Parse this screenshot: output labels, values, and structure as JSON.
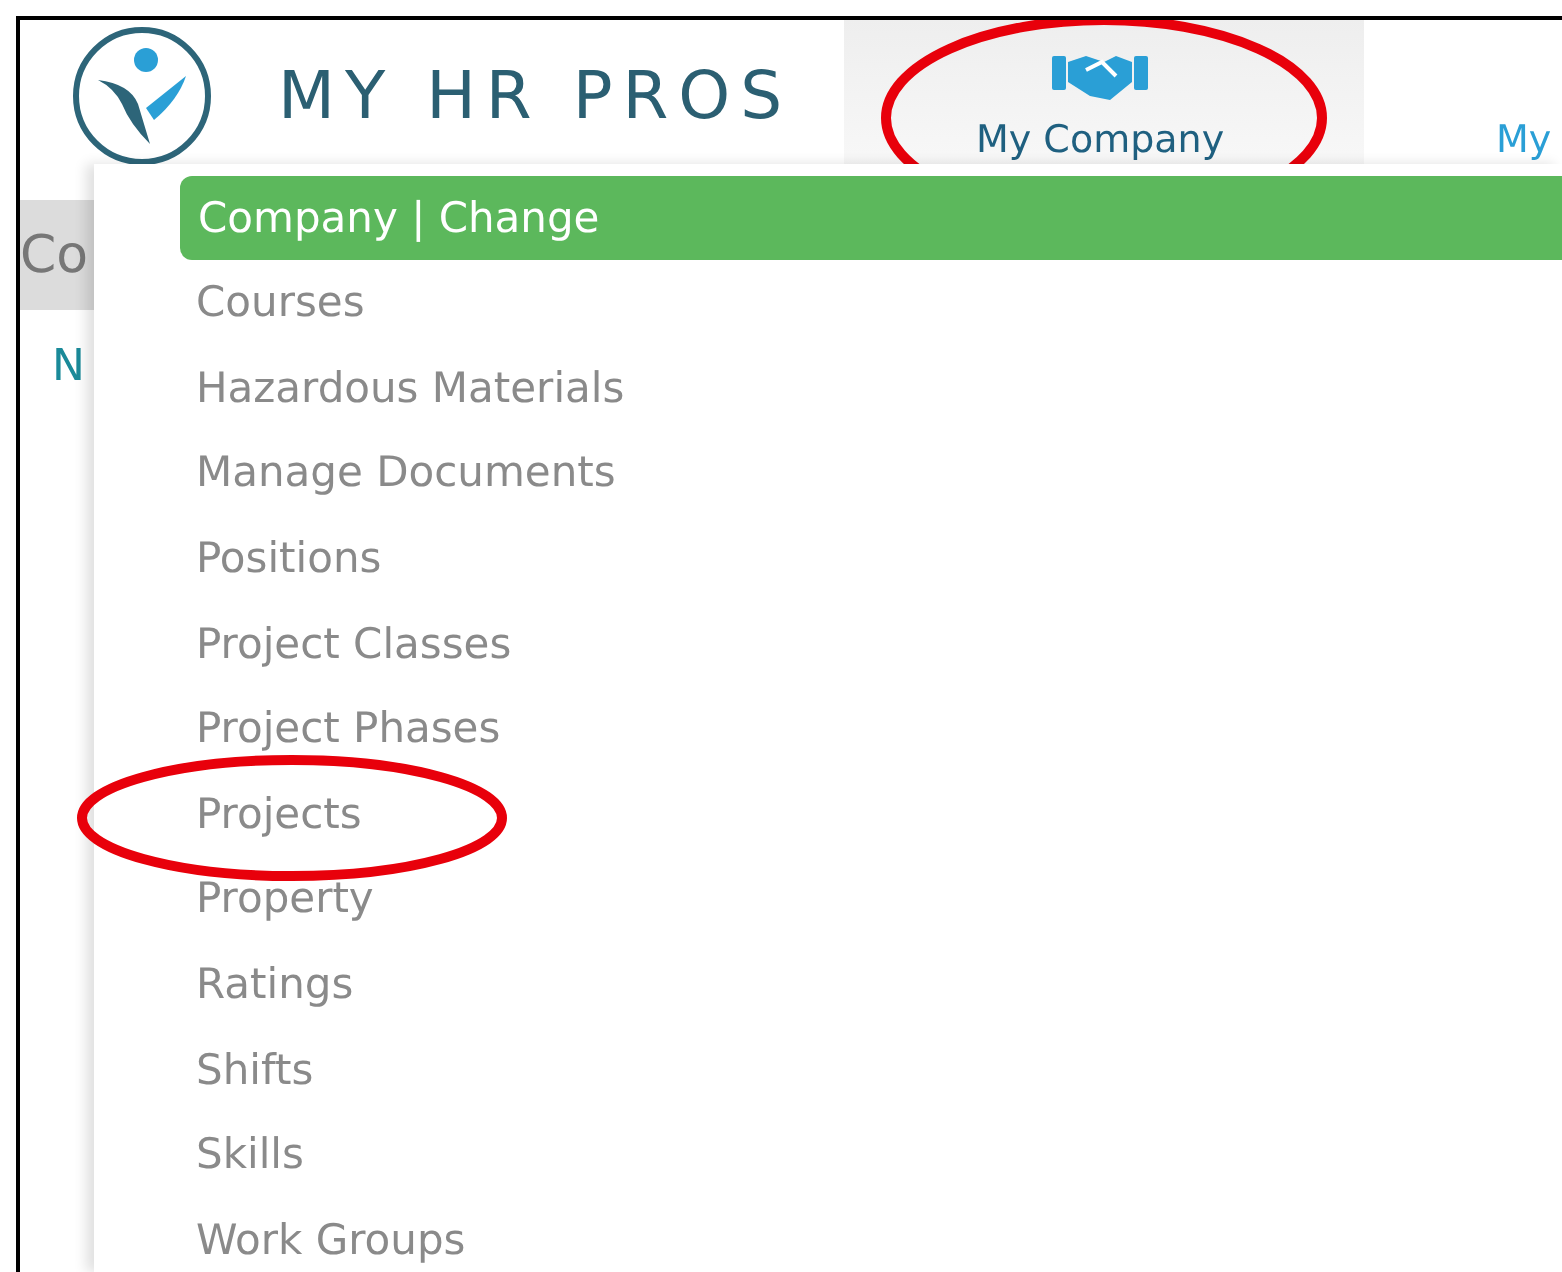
{
  "logo": {
    "text": "MY HR PROS"
  },
  "nav_tabs": [
    {
      "label": "My Company",
      "kind": "icon",
      "selected": true,
      "circled": true
    },
    {
      "label": "My",
      "kind": "text",
      "selected": false,
      "circled": false
    }
  ],
  "page": {
    "heading": "Co",
    "subheading": "N"
  },
  "dropdown": {
    "header": "Company | Change",
    "items": [
      {
        "label": "Courses",
        "circled": false
      },
      {
        "label": "Hazardous Materials",
        "circled": false
      },
      {
        "label": "Manage Documents",
        "circled": false
      },
      {
        "label": "Positions",
        "circled": false
      },
      {
        "label": "Project Classes",
        "circled": false
      },
      {
        "label": "Project Phases",
        "circled": false
      },
      {
        "label": "Projects",
        "circled": true
      },
      {
        "label": "Property",
        "circled": false
      },
      {
        "label": "Ratings",
        "circled": false
      },
      {
        "label": "Shifts",
        "circled": false
      },
      {
        "label": "Skills",
        "circled": false
      },
      {
        "label": "Work Groups",
        "circled": false
      }
    ]
  }
}
